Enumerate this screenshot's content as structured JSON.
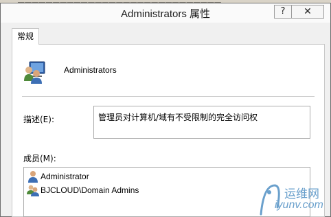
{
  "window": {
    "title": "Administrators 属性",
    "help_label": "?",
    "close_label": "✕"
  },
  "tabs": [
    {
      "label": "常规"
    }
  ],
  "group": {
    "name": "Administrators",
    "icon": "group-users-icon"
  },
  "description": {
    "label": "描述(E):",
    "value": "管理员对计算机/域有不受限制的完全访问权"
  },
  "members": {
    "label": "成员(M):",
    "items": [
      {
        "name": "Administrator",
        "icon": "user-icon"
      },
      {
        "name": "BJCLOUD\\Domain Admins",
        "icon": "group-icon"
      }
    ]
  },
  "watermark": {
    "cn": "运维网",
    "en": "iyunv.com"
  },
  "colors": {
    "accent": "#3b78c5",
    "watermark": "#6aa0cc"
  }
}
